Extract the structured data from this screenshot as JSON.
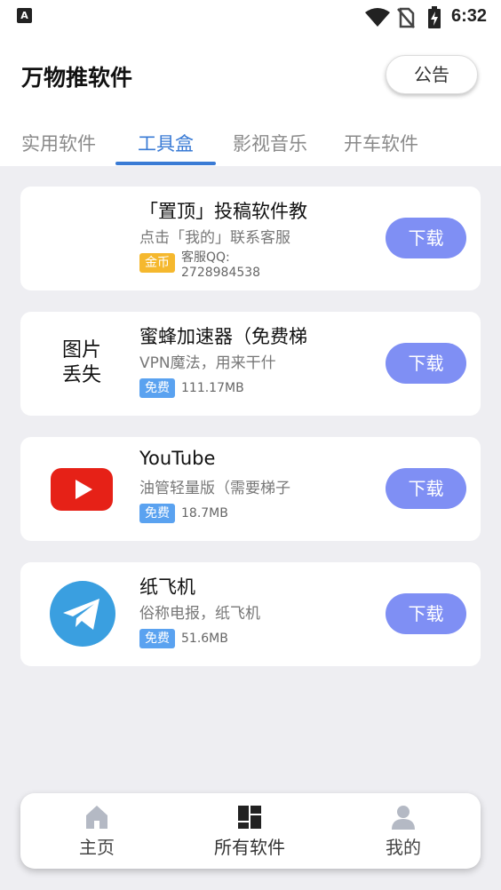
{
  "status_bar": {
    "time": "6:32",
    "icons": [
      "a-badge-icon",
      "wifi-icon",
      "no-sim-icon",
      "battery-charging-icon"
    ]
  },
  "header": {
    "title": "万物推软件",
    "notice_label": "公告"
  },
  "tabs": [
    {
      "label": "实用软件",
      "active": false
    },
    {
      "label": "工具盒",
      "active": true
    },
    {
      "label": "影视音乐",
      "active": false
    },
    {
      "label": "开车软件",
      "active": false
    }
  ],
  "apps": [
    {
      "name": "「置顶」投稿软件教",
      "desc": "点击「我的」联系客服",
      "tag": "金币",
      "tag_color": "#f5b82e",
      "size_line1": "客服QQ:",
      "size_line2": "2728984538",
      "button": "下载",
      "icon": "blank"
    },
    {
      "name": "蜜蜂加速器（免费梯",
      "desc": "VPN魔法，用来干什",
      "tag": "免费",
      "tag_color": "#5aa2f0",
      "size": "111.17MB",
      "button": "下载",
      "icon": "image-missing",
      "icon_text_1": "图片",
      "icon_text_2": "丢失"
    },
    {
      "name": "YouTube",
      "desc": "油管轻量版（需要梯子",
      "tag": "免费",
      "tag_color": "#5aa2f0",
      "size": "18.7MB",
      "button": "下载",
      "icon": "youtube-icon"
    },
    {
      "name": "纸飞机",
      "desc": "俗称电报，纸飞机",
      "tag": "免费",
      "tag_color": "#5aa2f0",
      "size": "51.6MB",
      "button": "下载",
      "icon": "telegram-icon"
    }
  ],
  "bottom_nav": [
    {
      "label": "主页",
      "icon": "home-icon"
    },
    {
      "label": "所有软件",
      "icon": "apps-grid-icon",
      "active": true
    },
    {
      "label": "我的",
      "icon": "person-icon"
    }
  ],
  "colors": {
    "accent": "#3a7bd5",
    "download_button": "#7f8ff4",
    "background": "#eeeef2"
  }
}
